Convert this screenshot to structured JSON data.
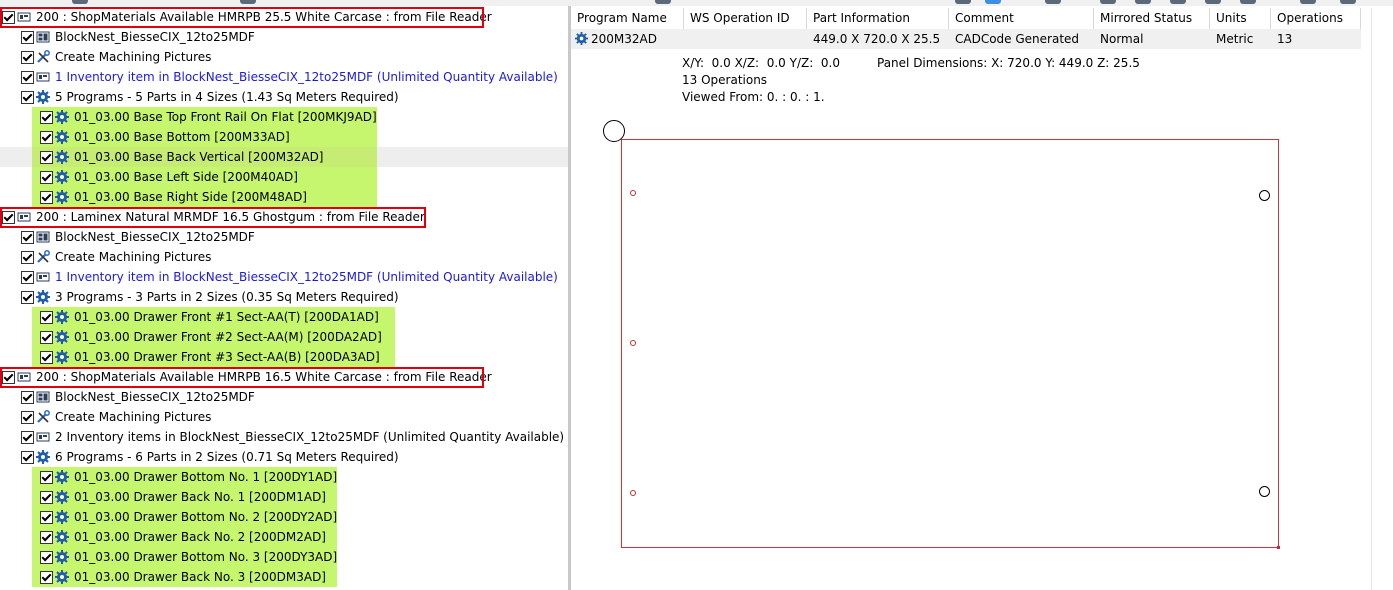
{
  "tree": {
    "groups": [
      {
        "header": "200 : ShopMaterials Available HMRPB 25.5 White Carcase : from File Reader",
        "nest": "BlockNest_BiesseCIX_12to25MDF",
        "pictures": "Create Machining Pictures",
        "inventory": "1 Inventory item in BlockNest_BiesseCIX_12to25MDF (Unlimited Quantity Available)",
        "programs": "5 Programs - 5 Parts in 4 Sizes (1.43 Sq Meters Required)",
        "parts": [
          "01_03.00 Base Top Front Rail On Flat [200MKJ9AD]",
          "01_03.00 Base Bottom [200M33AD]",
          "01_03.00 Base Back Vertical [200M32AD]",
          "01_03.00 Base Left Side [200M40AD]",
          "01_03.00 Base Right Side [200M48AD]"
        ]
      },
      {
        "header": "200 : Laminex Natural MRMDF 16.5 Ghostgum : from File Reader",
        "nest": "BlockNest_BiesseCIX_12to25MDF",
        "pictures": "Create Machining Pictures",
        "inventory": "1 Inventory item in BlockNest_BiesseCIX_12to25MDF (Unlimited Quantity Available)",
        "programs": "3 Programs - 3 Parts in 2 Sizes (0.35 Sq Meters Required)",
        "parts": [
          "01_03.00 Drawer Front #1 Sect-AA(T) [200DA1AD]",
          "01_03.00 Drawer Front #2 Sect-AA(M) [200DA2AD]",
          "01_03.00 Drawer Front #3 Sect-AA(B) [200DA3AD]"
        ]
      },
      {
        "header": "200 : ShopMaterials Available HMRPB 16.5 White Carcase : from File Reader",
        "nest": "BlockNest_BiesseCIX_12to25MDF",
        "pictures": "Create Machining Pictures",
        "inventory": "2 Inventory items in BlockNest_BiesseCIX_12to25MDF (Unlimited Quantity Available)",
        "programs": "6 Programs - 6 Parts in 2 Sizes (0.71 Sq Meters Required)",
        "parts": [
          "01_03.00 Drawer Bottom No. 1 [200DY1AD]",
          "01_03.00 Drawer Back No. 1 [200DM1AD]",
          "01_03.00 Drawer Bottom No. 2 [200DY2AD]",
          "01_03.00 Drawer Back No. 2 [200DM2AD]",
          "01_03.00 Drawer Bottom No. 3 [200DY3AD]",
          "01_03.00 Drawer Back No. 3 [200DM3AD]"
        ]
      }
    ]
  },
  "grid": {
    "columns": [
      "Program Name",
      "WS Operation ID",
      "Part Information",
      "Comment",
      "Mirrored Status",
      "Units",
      "Operations"
    ],
    "row": {
      "program": "200M32AD",
      "ws_op_id": "",
      "part_info": "449.0 X 720.0 X 25.5",
      "comment": "CADCode Generated",
      "mirrored": "Normal",
      "units": "Metric",
      "operations": "13"
    }
  },
  "info": {
    "coords": "X/Y:  0.0 X/Z:  0.0 Y/Z:  0.0",
    "dimensions": "Panel Dimensions: X: 720.0 Y: 449.0 Z: 25.5",
    "ops": "13 Operations",
    "viewed": "Viewed From: 0. : 0. : 1."
  },
  "colors": {
    "highlight": "#c6f56e",
    "selection_box": "#e0000c",
    "link_text": "#1a1adc",
    "panel_outline": "#d0343a"
  },
  "icons": {
    "header": "material-icon",
    "nest": "nest-icon",
    "pictures": "tools-icon",
    "inventory": "inventory-icon",
    "programs": "gear-icon",
    "part": "gear-icon"
  }
}
